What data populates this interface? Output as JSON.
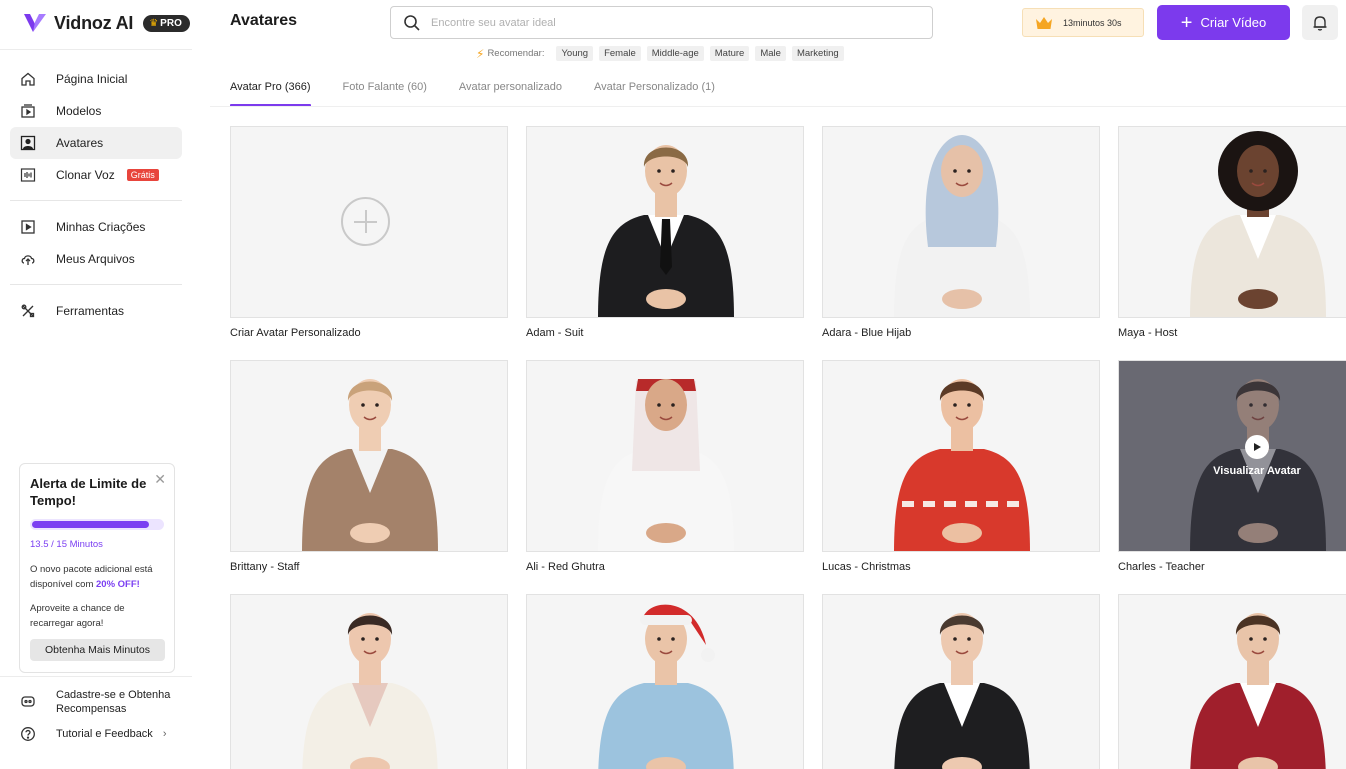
{
  "brand": {
    "name": "Vidnoz AI",
    "badge": "PRO"
  },
  "sidebar": {
    "main_items": [
      {
        "label": "Página Inicial",
        "icon": "home-icon"
      },
      {
        "label": "Modelos",
        "icon": "templates-icon"
      },
      {
        "label": "Avatares",
        "icon": "avatar-icon",
        "active": true
      },
      {
        "label": "Clonar Voz",
        "icon": "voice-icon",
        "badge": "Grátis"
      }
    ],
    "secondary_items": [
      {
        "label": "Minhas Criações",
        "icon": "play-box-icon"
      },
      {
        "label": "Meus Arquivos",
        "icon": "upload-cloud-icon"
      }
    ],
    "tools_items": [
      {
        "label": "Ferramentas",
        "icon": "tools-icon"
      }
    ],
    "bottom_items": [
      {
        "label": "Cadastre-se e Obtenha Recompensas",
        "icon": "gift-icon"
      },
      {
        "label": "Tutorial e Feedback",
        "icon": "help-icon"
      }
    ]
  },
  "alert": {
    "title": "Alerta de Limite de Tempo!",
    "usage": "13.5 / 15 Minutos",
    "usage_fraction": 0.9,
    "text1_pre": "O novo pacote adicional está disponível com ",
    "text1_highlight": "20% OFF!",
    "text2": "Aproveite a chance de recarregar agora!",
    "button": "Obtenha Mais Minutos"
  },
  "header": {
    "title": "Avatares",
    "search_placeholder": "Encontre seu avatar ideal",
    "recommend_label": "Recomendar:",
    "tags": [
      "Young",
      "Female",
      "Middle-age",
      "Mature",
      "Male",
      "Marketing"
    ],
    "timer": "13minutos 30s",
    "create_button": "Criar Vídeo"
  },
  "tabs": [
    {
      "label": "Avatar Pro (366)",
      "active": true
    },
    {
      "label": "Foto Falante (60)"
    },
    {
      "label": "Avatar personalizado"
    },
    {
      "label": "Avatar Personalizado (1)"
    }
  ],
  "cards": [
    {
      "name": "Criar Avatar Personalizado",
      "type": "create"
    },
    {
      "name": "Adam - Suit",
      "skin": "#e9c3a6",
      "hair": "#8a6a45",
      "outfit": "#1d1d1f",
      "shirt": "#ffffff",
      "tie": "#111111"
    },
    {
      "name": "Adara - Blue Hijab",
      "skin": "#e6c1a8",
      "hair": "#b7c8dc",
      "outfit": "#f2f2f2",
      "shirt": "#f2f2f2",
      "hijab": true
    },
    {
      "name": "Maya - Host",
      "skin": "#6b4330",
      "hair": "#1b1412",
      "outfit": "#ece6dc",
      "shirt": "#ffffff",
      "afro": true
    },
    {
      "name": "Brittany - Staff",
      "skin": "#efcdb3",
      "hair": "#c9a27a",
      "outfit": "#a4826a",
      "shirt": "#f3f3f3"
    },
    {
      "name": "Ali - Red Ghutra",
      "skin": "#d9a888",
      "hair": "#3a2a22",
      "outfit": "#f7f7f7",
      "shirt": "#f7f7f7",
      "ghutra": true
    },
    {
      "name": "Lucas - Christmas",
      "skin": "#ecc0a2",
      "hair": "#5b3a26",
      "outfit": "#d8392c",
      "shirt": "#d8392c",
      "pattern": true
    },
    {
      "name": "Charles - Teacher",
      "skin": "#dcb7a0",
      "hair": "#3b312c",
      "outfit": "#2b2b30",
      "shirt": "#d9d9dd",
      "overlay": true
    },
    {
      "name": "",
      "skin": "#edc7ae",
      "hair": "#3a2a24",
      "outfit": "#f3efe6",
      "shirt": "#e6c9bf"
    },
    {
      "name": "",
      "skin": "#eac4a8",
      "hair": "#3a2a24",
      "outfit": "#9cc3de",
      "shirt": "#9cc3de",
      "santa": true
    },
    {
      "name": "",
      "skin": "#edc9b0",
      "hair": "#4a3a30",
      "outfit": "#1e1e20",
      "shirt": "#ffffff"
    },
    {
      "name": "",
      "skin": "#e9c4a9",
      "hair": "#4b3324",
      "outfit": "#a01f2c",
      "shirt": "#ffffff"
    }
  ],
  "overlay": {
    "label": "Visualizar Avatar"
  },
  "colors": {
    "accent": "#7c3aed",
    "badge_red": "#e8453c"
  }
}
